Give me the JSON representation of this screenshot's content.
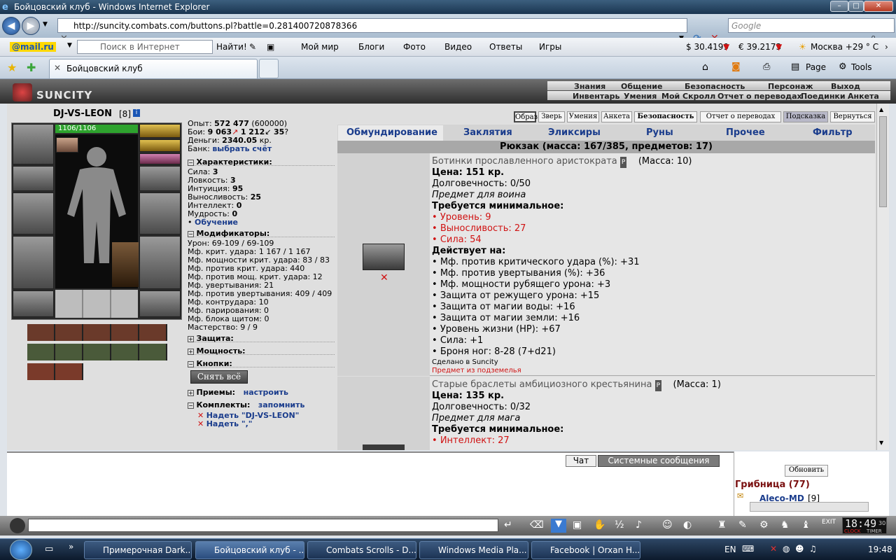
{
  "window": {
    "title": "Бойцовский клуб - Windows Internet Explorer"
  },
  "browser": {
    "url": "http://suncity.combats.com/buttons.pl?battle=0.281400720878366",
    "search_placeholder": "Google",
    "tab_title": "Бойцовский клуб",
    "page_label": "Page",
    "tools_label": "Tools"
  },
  "mailbar": {
    "brand": "@mail.ru",
    "search_placeholder": "Поиск в Интернет",
    "find": "Найти!",
    "links": [
      "Мой мир",
      "Блоги",
      "Фото",
      "Видео",
      "Ответы",
      "Игры"
    ],
    "usd": "$ 30.4199",
    "eur": "€ 39.2173",
    "weather": "Москва +29 ° С"
  },
  "game": {
    "logo": "SUNCITY",
    "menu_top": [
      "Знания",
      "Общение",
      "Безопасность",
      "Персонаж",
      "Выход"
    ],
    "menu_bottom": [
      "Инвентарь",
      "Умения",
      "Мой Скролл",
      "Отчет о переводах",
      "Поединки",
      "Анкета"
    ],
    "char": {
      "name": "DJ-VS-LEON",
      "level": "[8]",
      "hp": "1106/1106",
      "exp_label": "Опыт:",
      "exp": "572 477",
      "exp_next": "(600000)",
      "fights_label": "Бои:",
      "wins": "9 063",
      "losses": "1 212",
      "draws": "35",
      "money_label": "Деньги:",
      "money": "2340.05",
      "money_unit": "кр.",
      "bank_label": "Банк:",
      "bank_link": "выбрать счёт"
    },
    "sections": {
      "stats": "Характеристики:",
      "mods": "Модификаторы:",
      "protection": "Защита:",
      "power": "Мощность:",
      "buttons": "Кнопки:",
      "tricks": "Приемы:",
      "sets": "Комплекты:"
    },
    "stats": [
      {
        "label": "Сила:",
        "value": "3"
      },
      {
        "label": "Ловкость:",
        "value": "3"
      },
      {
        "label": "Интуиция:",
        "value": "95"
      },
      {
        "label": "Выносливость:",
        "value": "25"
      },
      {
        "label": "Интеллект:",
        "value": "0"
      },
      {
        "label": "Мудрость:",
        "value": "0"
      }
    ],
    "training": "Обучение",
    "mods": [
      "Урон: 69-109 / 69-109",
      "Мф. крит. удара: 1 167 / 1 167",
      "Мф. мощности крит. удара: 83 / 83",
      "Мф. против крит. удара: 440",
      "Мф. против мощ. крит. удара: 12",
      "Мф. увертывания: 21",
      "Мф. против увертывания: 409 / 409",
      "Мф. контрудара: 10",
      "Мф. парирования: 0",
      "Мф. блока щитом: 0",
      "Мастерство: 9 / 9"
    ],
    "undress_btn": "Снять всё",
    "tricks_link": "настроить",
    "sets_link": "запомнить",
    "sets": [
      "Надеть \"DJ-VS-LEON\"",
      "Надеть \",\""
    ],
    "top_buttons": [
      "Образ",
      "Зверь",
      "Умения",
      "Анкета",
      "Безопасность",
      "Отчет о переводах",
      "Подсказка",
      "Вернуться"
    ],
    "inv_tabs": [
      "Обмундирование",
      "Заклятия",
      "Эликсиры",
      "Руны",
      "Прочее",
      "Фильтр"
    ],
    "backpack": "Рюкзак (масса: 167/385, предметов: 17)",
    "item1": {
      "name": "Ботинки прославленного аристократа",
      "mass": "(Масса: 10)",
      "price": "Цена: 151 кр.",
      "durability": "Долговечность: 0/50",
      "class": "Предмет для воина",
      "req_title": "Требуется минимальное:",
      "reqs": [
        "Уровень: 9",
        "Выносливость: 27",
        "Сила: 54"
      ],
      "acts_title": "Действует на:",
      "acts": [
        "Мф. против критического удара (%): +31",
        "Мф. против увертывания (%): +36",
        "Мф. мощности рубящего урона: +3",
        "Защита от режущего урона: +15",
        "Защита от магии воды: +16",
        "Защита от магии земли: +16",
        "Уровень жизни (HP): +67",
        "Сила: +1",
        "Броня ног: 8-28 (7+d21)"
      ],
      "made": "Сделано в Suncity",
      "dungeon": "Предмет из подземелья"
    },
    "item2": {
      "name": "Старые браслеты амбициозного крестьянина",
      "mass": "(Масса: 1)",
      "price": "Цена: 135 кр.",
      "durability": "Долговечность: 0/32",
      "class": "Предмет для мага",
      "req_title": "Требуется минимальное:",
      "reqs": [
        "Интеллект: 27"
      ]
    },
    "chat_tabs": [
      "Чат",
      "Системные сообщения"
    ],
    "refresh": "Обновить",
    "location": "Грибница (77)",
    "online_user": "Aleco-MD",
    "online_level": "[9]",
    "clock": "18:49",
    "clock_sec": "30",
    "clock_labels": [
      "CLOCK",
      "TIMER"
    ]
  },
  "taskbar": {
    "tasks": [
      "Примерочная Dark...",
      "Бойцовский клуб - ...",
      "Combats Scrolls - D...",
      "Windows Media Pla...",
      "Facebook | Orxan H..."
    ],
    "lang": "EN",
    "time": "19:48"
  }
}
